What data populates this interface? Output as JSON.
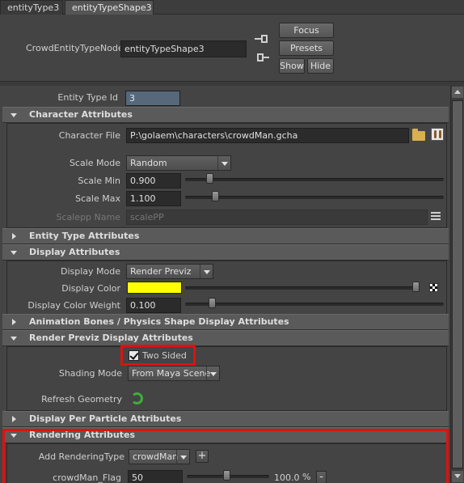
{
  "tabs": [
    "entityType3",
    "entityTypeShape3"
  ],
  "header": {
    "node_label": "CrowdEntityTypeNode:",
    "node_value": "entityTypeShape3",
    "focus_label": "Focus",
    "presets_label": "Presets",
    "show_label": "Show",
    "hide_label": "Hide"
  },
  "entity_type_id": {
    "label": "Entity Type Id",
    "value": "3"
  },
  "character_attributes": {
    "title": "Character Attributes",
    "character_file_label": "Character File",
    "character_file_value": "P:\\golaem\\characters\\crowdMan.gcha",
    "scale_mode_label": "Scale Mode",
    "scale_mode_value": "Random",
    "scale_min_label": "Scale Min",
    "scale_min_value": "0.900",
    "scale_min_level": 0.17,
    "scale_max_label": "Scale Max",
    "scale_max_value": "1.100",
    "scale_max_level": 0.21,
    "scalepp_label": "Scalepp Name",
    "scalepp_placeholder": "scalePP"
  },
  "entity_type_attributes": {
    "title": "Entity Type Attributes"
  },
  "display_attributes": {
    "title": "Display Attributes",
    "display_mode_label": "Display Mode",
    "display_mode_value": "Render Previz",
    "display_color_label": "Display Color",
    "display_color": "#ffff00",
    "display_color_level": 1.0,
    "display_color_weight_label": "Display Color Weight",
    "display_color_weight_value": "0.100",
    "display_color_weight_level": 0.1
  },
  "animation_bones": {
    "title": "Animation Bones / Physics Shape Display Attributes"
  },
  "render_previz": {
    "title": "Render Previz Display Attributes",
    "two_sided_label": "Two Sided",
    "two_sided_checked": true,
    "shading_mode_label": "Shading Mode",
    "shading_mode_value": "From Maya Scene",
    "refresh_geometry_label": "Refresh Geometry"
  },
  "display_per_particle": {
    "title": "Display Per Particle Attributes"
  },
  "rendering_attributes": {
    "title": "Rendering Attributes",
    "add_rendering_type_label": "Add RenderingType",
    "add_rendering_type_value": "crowdMan",
    "add_button_label": "+",
    "flag_label": "crowdMan_Flag",
    "flag_value": "50",
    "flag_level": 0.5,
    "percent_value": "100.0",
    "percent_unit": "%",
    "remove_button_label": "-"
  },
  "colors": {
    "highlight_red": "#e01010",
    "display_color": "#ffff00",
    "panel_bg": "#444444"
  }
}
